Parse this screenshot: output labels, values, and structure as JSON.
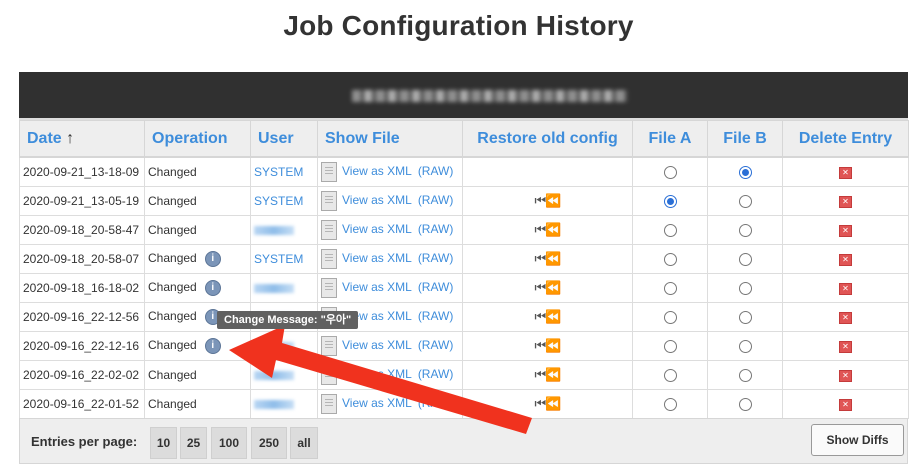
{
  "page": {
    "title": "Job Configuration History"
  },
  "table": {
    "columns": [
      "Date",
      "Operation",
      "User",
      "Show File",
      "Restore old config",
      "File A",
      "File B",
      "Delete Entry"
    ],
    "sort_indicator": "↑",
    "rows": [
      {
        "date": "2020-09-21_13-18-09",
        "operation": "Changed",
        "user": "SYSTEM",
        "view_label": "View as XML",
        "raw_label": "(RAW)",
        "restore": "",
        "file_a_checked": false,
        "file_b_checked": true
      },
      {
        "date": "2020-09-21_13-05-19",
        "operation": "Changed",
        "user": "SYSTEM",
        "view_label": "View as XML",
        "raw_label": "(RAW)",
        "restore": "⏮⏪",
        "file_a_checked": true,
        "file_b_checked": false
      },
      {
        "date": "2020-09-18_20-58-47",
        "operation": "Changed",
        "user": "",
        "view_label": "View as XML",
        "raw_label": "(RAW)",
        "restore": "⏮⏪",
        "file_a_checked": false,
        "file_b_checked": false
      },
      {
        "date": "2020-09-18_20-58-07",
        "operation": "Changed",
        "user": "SYSTEM",
        "view_label": "View as XML",
        "raw_label": "(RAW)",
        "restore": "⏮⏪",
        "file_a_checked": false,
        "file_b_checked": false
      },
      {
        "date": "2020-09-18_16-18-02",
        "operation": "Changed",
        "user": "",
        "view_label": "View as XML",
        "raw_label": "(RAW)",
        "restore": "⏮⏪",
        "file_a_checked": false,
        "file_b_checked": false
      },
      {
        "date": "2020-09-16_22-12-56",
        "operation": "Changed",
        "user": "",
        "view_label": "View as XML",
        "raw_label": "(RAW)",
        "restore": "⏮⏪",
        "file_a_checked": false,
        "file_b_checked": false
      },
      {
        "date": "2020-09-16_22-12-16",
        "operation": "Changed",
        "user": "",
        "view_label": "View as XML",
        "raw_label": "(RAW)",
        "restore": "⏮⏪",
        "file_a_checked": false,
        "file_b_checked": false
      },
      {
        "date": "2020-09-16_22-02-02",
        "operation": "Changed",
        "user": "",
        "view_label": "View as XML",
        "raw_label": "(RAW)",
        "restore": "⏮⏪",
        "file_a_checked": false,
        "file_b_checked": false
      },
      {
        "date": "2020-09-16_22-01-52",
        "operation": "Changed",
        "user": "",
        "view_label": "View as XML",
        "raw_label": "(RAW)",
        "restore": "⏮⏪",
        "file_a_checked": false,
        "file_b_checked": false
      }
    ]
  },
  "tooltip": {
    "text": "Change Message: \"우아\""
  },
  "footer": {
    "entries_label": "Entries per page:",
    "page_sizes": [
      "10",
      "25",
      "100",
      "250",
      "all"
    ],
    "show_diffs_label": "Show Diffs"
  },
  "icons": {
    "info": "info-icon",
    "file": "file-icon",
    "restore": "restore-icon",
    "delete": "delete-icon"
  },
  "colors": {
    "link": "#3e8ddb",
    "header_bar": "#303030",
    "annotation_arrow": "#f0321e"
  }
}
